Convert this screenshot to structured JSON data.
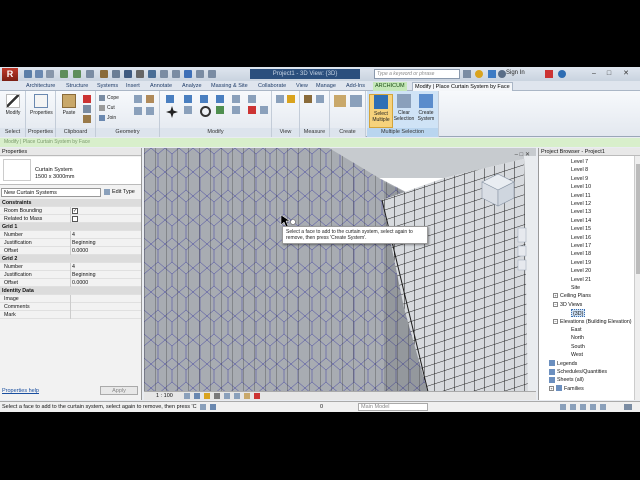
{
  "titlebar": {
    "app_title": "Project1 - 3D View: {3D}",
    "search_placeholder": "Type a keyword or phrase",
    "sign_in": "Sign In",
    "logo_letter": "R"
  },
  "tabs": [
    "Architecture",
    "Structure",
    "Systems",
    "Insert",
    "Annotate",
    "Analyze",
    "Massing & Site",
    "Collaborate",
    "View",
    "Manage",
    "Add-Ins",
    "ARCHICUM",
    "Modify | Place Curtain System by Face"
  ],
  "ribbon": {
    "select": {
      "modify": "Modify",
      "label": "Select"
    },
    "properties": {
      "button": "Properties",
      "label": "Properties"
    },
    "clipboard": {
      "paste": "Paste",
      "label": "Clipboard"
    },
    "geometry": {
      "cope": "Cope",
      "cut": "Cut",
      "join": "Join",
      "label": "Geometry"
    },
    "modify_label": "Modify",
    "view_label": "View",
    "measure_label": "Measure",
    "create_label": "Create",
    "multiple": {
      "select_multiple": "Select Multiple",
      "clear_selection": "Clear Selection",
      "create_system": "Create System",
      "label": "Multiple Selection"
    }
  },
  "options_bar": "Modify | Place Curtain System by Face",
  "properties": {
    "title": "Properties",
    "family": "Curtain System",
    "type": "1500 x 3000mm",
    "selector": "New Curtain Systems",
    "edit_type": "Edit Type",
    "rows": [
      {
        "kind": "cat",
        "key": "Constraints"
      },
      {
        "kind": "row",
        "key": "Room Bounding",
        "check": true
      },
      {
        "kind": "row",
        "key": "Related to Mass",
        "check": false
      },
      {
        "kind": "cat",
        "key": "Grid 1"
      },
      {
        "kind": "row",
        "key": "Number",
        "value": "4"
      },
      {
        "kind": "row",
        "key": "Justification",
        "value": "Beginning"
      },
      {
        "kind": "row",
        "key": "Offset",
        "value": "0.0000"
      },
      {
        "kind": "cat",
        "key": "Grid 2"
      },
      {
        "kind": "row",
        "key": "Number",
        "value": "4"
      },
      {
        "kind": "row",
        "key": "Justification",
        "value": "Beginning"
      },
      {
        "kind": "row",
        "key": "Offset",
        "value": "0.0000"
      },
      {
        "kind": "cat",
        "key": "Identity Data"
      },
      {
        "kind": "row",
        "key": "Image",
        "value": ""
      },
      {
        "kind": "row",
        "key": "Comments",
        "value": ""
      },
      {
        "kind": "row",
        "key": "Mark",
        "value": ""
      }
    ],
    "help_link": "Properties help",
    "apply": "Apply"
  },
  "viewport": {
    "tooltip": "Select a face to add to the curtain system, select again to remove, then press 'Create System'.",
    "scale": "1 : 100"
  },
  "browser": {
    "title": "Project Browser - Project1",
    "levels": [
      "Level 7",
      "Level 8",
      "Level 9",
      "Level 10",
      "Level 11",
      "Level 12",
      "Level 13",
      "Level 14",
      "Level 15",
      "Level 16",
      "Level 17",
      "Level 18",
      "Level 19",
      "Level 20",
      "Level 21",
      "Site"
    ],
    "ceiling_plans": "Ceiling Plans",
    "views_3d": "3D Views",
    "view_3d_item": "{3D}",
    "elevations": "Elevations (Building Elevation)",
    "elevation_items": [
      "East",
      "North",
      "South",
      "West"
    ],
    "legends": "Legends",
    "schedules": "Schedules/Quantities",
    "sheets": "Sheets (all)",
    "families": "Families"
  },
  "status": {
    "message": "Select a face to add to the curtain system, select again to remove, then press 'Cr",
    "main_model": "Main Model",
    "zero": "0"
  }
}
